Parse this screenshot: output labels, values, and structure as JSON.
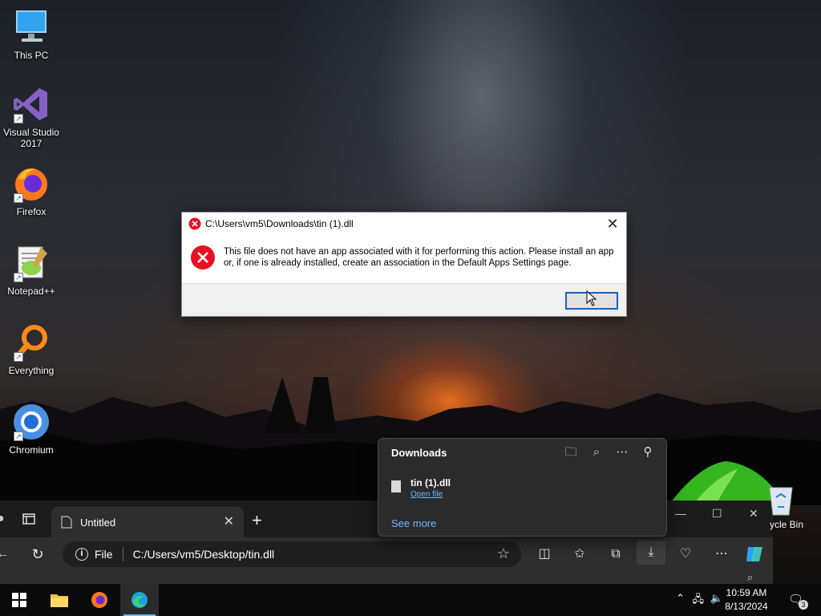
{
  "desktop": {
    "icons": [
      {
        "label": "This PC",
        "name": "this-pc"
      },
      {
        "label": "Visual Studio 2017",
        "name": "visual-studio"
      },
      {
        "label": "Firefox",
        "name": "firefox"
      },
      {
        "label": "Notepad++",
        "name": "notepad-plus-plus"
      },
      {
        "label": "Everything",
        "name": "everything"
      },
      {
        "label": "Chromium",
        "name": "chromium"
      }
    ],
    "recycle_bin_label": "ycle Bin"
  },
  "dialog": {
    "title": "C:\\Users\\vm5\\Downloads\\tin (1).dll",
    "message": "This file does not have an app associated with it for performing this action. Please install an app or, if one is already installed, create an association in the Default Apps Settings page.",
    "ok_label": ""
  },
  "browser": {
    "tab_title": "Untitled",
    "address_scheme_label": "File",
    "address_url": "C:/Users/vm5/Desktop/tin.dll"
  },
  "downloads": {
    "header": "Downloads",
    "items": [
      {
        "file_name": "tin (1).dll",
        "action_label": "Open file"
      }
    ],
    "see_more_label": "See more"
  },
  "taskbar": {
    "time": "10:59 AM",
    "date": "8/13/2024",
    "notification_count": "3"
  },
  "colors": {
    "accent": "#1a62c4",
    "error_red": "#e81123",
    "link_blue": "#6cb8ff"
  }
}
